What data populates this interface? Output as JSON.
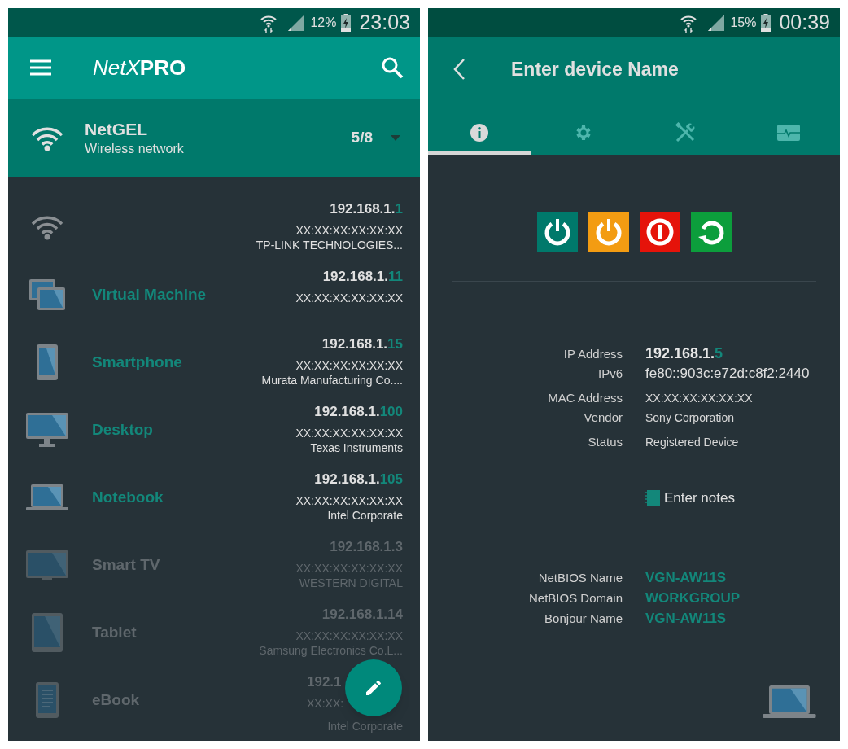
{
  "left_screen": {
    "status_bar": {
      "battery": "12%",
      "time": "23:03"
    },
    "app_bar": {
      "brand": "NetX",
      "brand_suffix": "PRO"
    },
    "network": {
      "name": "NetGEL",
      "type": "Wireless network",
      "count": "5/8"
    },
    "devices": [
      {
        "kind": "router",
        "online": true,
        "covered": false,
        "ip_prefix": "192.168.1.",
        "ip_host": "1",
        "mac": "XX:XX:XX:XX:XX:XX",
        "vendor": "TP-LINK TECHNOLOGIES..."
      },
      {
        "kind": "vm",
        "online": true,
        "covered": false,
        "name": "Virtual Machine",
        "ip_prefix": "192.168.1.",
        "ip_host": "11",
        "mac": "XX:XX:XX:XX:XX:XX"
      },
      {
        "kind": "phone",
        "online": true,
        "covered": false,
        "name": "Smartphone",
        "ip_prefix": "192.168.1.",
        "ip_host": "15",
        "mac": "XX:XX:XX:XX:XX:XX",
        "vendor": "Murata Manufacturing Co...."
      },
      {
        "kind": "desktop",
        "online": true,
        "covered": false,
        "name": "Desktop",
        "ip_prefix": "192.168.1.",
        "ip_host": "100",
        "mac": "XX:XX:XX:XX:XX:XX",
        "vendor": "Texas Instruments"
      },
      {
        "kind": "laptop",
        "online": true,
        "covered": false,
        "name": "Notebook",
        "ip_prefix": "192.168.1.",
        "ip_host": "105",
        "mac": "XX:XX:XX:XX:XX:XX",
        "vendor": "Intel Corporate"
      },
      {
        "kind": "tv",
        "online": false,
        "covered": false,
        "name": "Smart TV",
        "ip_prefix": "192.168.1.",
        "ip_host": "3",
        "mac": "XX:XX:XX:XX:XX:XX",
        "vendor": "WESTERN DIGITAL"
      },
      {
        "kind": "tablet",
        "online": false,
        "covered": false,
        "name": "Tablet",
        "ip_prefix": "192.168.1.",
        "ip_host": "14",
        "mac": "XX:XX:XX:XX:XX:XX",
        "vendor": "Samsung Electronics Co.L..."
      },
      {
        "kind": "ebook",
        "online": false,
        "covered": true,
        "name": "eBook",
        "ip_prefix": "192.1",
        "mac": "XX:XX:",
        "vendor": "Intel Corporate"
      }
    ]
  },
  "right_screen": {
    "status_bar": {
      "battery": "15%",
      "time": "00:39"
    },
    "app_bar": {
      "title": "Enter device Name"
    },
    "tabs": [
      {
        "kind": "info",
        "selected": true
      },
      {
        "kind": "settings",
        "selected": false
      },
      {
        "kind": "tools",
        "selected": false
      },
      {
        "kind": "monitor",
        "selected": false
      }
    ],
    "actions": [
      {
        "kind": "power",
        "color": "#00796b"
      },
      {
        "kind": "power",
        "color": "#f39c12"
      },
      {
        "kind": "off",
        "color": "#e5130a"
      },
      {
        "kind": "restart",
        "color": "#0c9e3c"
      }
    ],
    "details": [
      {
        "kind": "ip",
        "label": "IP Address",
        "value": "192.168.1.",
        "host": "5"
      },
      {
        "kind": "large",
        "label": "IPv6",
        "value": "fe80::903c:e72d:c8f2:2440"
      },
      {
        "kind": "plain",
        "label": "MAC Address",
        "value": "XX:XX:XX:XX:XX:XX",
        "gap": true
      },
      {
        "kind": "plain",
        "label": "Vendor",
        "value": "Sony Corporation"
      },
      {
        "kind": "plain",
        "label": "Status",
        "value": "Registered Device",
        "gap": true
      }
    ],
    "notes": "Enter notes",
    "names": [
      {
        "label": "NetBIOS Name",
        "value": "VGN-AW11S"
      },
      {
        "label": "NetBIOS Domain",
        "value": "WORKGROUP"
      },
      {
        "label": "Bonjour Name",
        "value": "VGN-AW11S"
      }
    ]
  }
}
